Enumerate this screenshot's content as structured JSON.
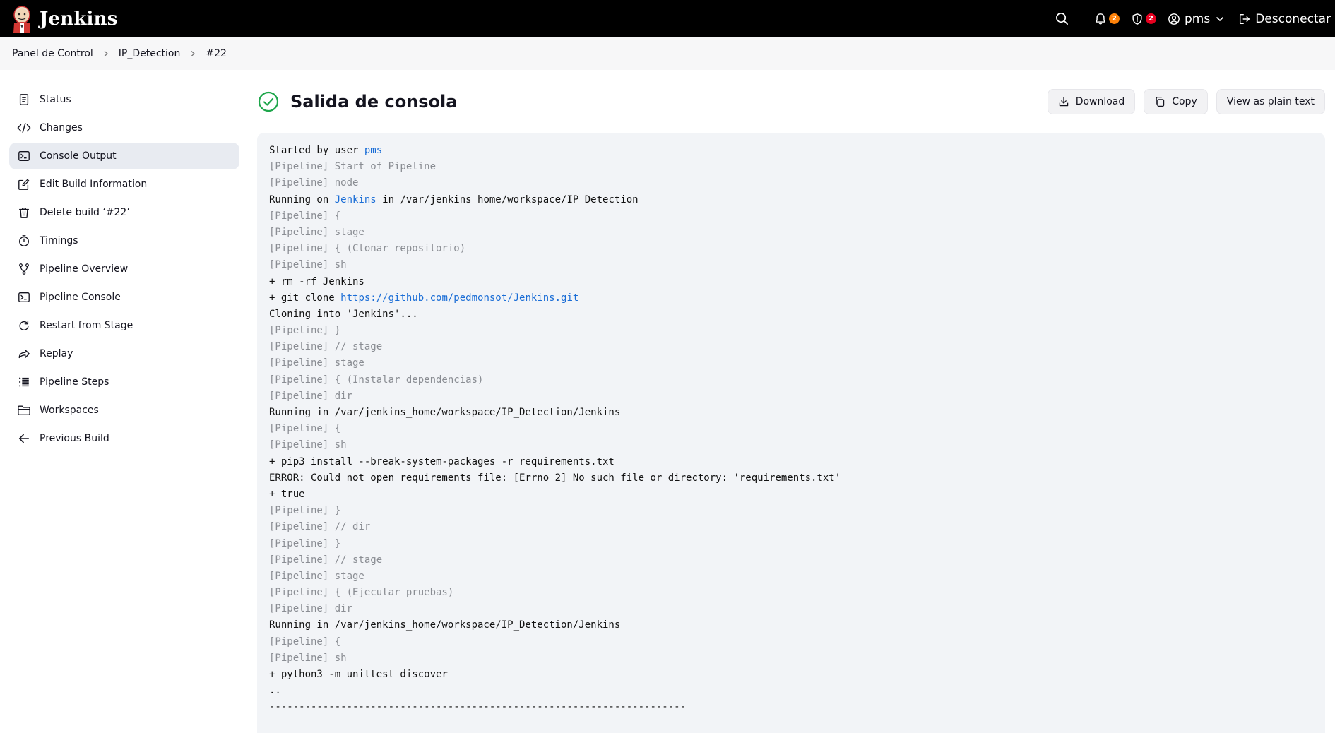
{
  "header": {
    "brand": "Jenkins",
    "notifications_count": "2",
    "security_count": "2",
    "user": "pms",
    "logout_label": "Desconectar"
  },
  "breadcrumbs": [
    "Panel de Control",
    "IP_Detection",
    "#22"
  ],
  "sidebar": {
    "items": [
      {
        "label": "Status",
        "icon": "status-icon"
      },
      {
        "label": "Changes",
        "icon": "code-icon"
      },
      {
        "label": "Console Output",
        "icon": "terminal-icon",
        "active": true
      },
      {
        "label": "Edit Build Information",
        "icon": "edit-icon"
      },
      {
        "label": "Delete build ‘#22’",
        "icon": "trash-icon"
      },
      {
        "label": "Timings",
        "icon": "stopwatch-icon"
      },
      {
        "label": "Pipeline Overview",
        "icon": "pipeline-icon"
      },
      {
        "label": "Pipeline Console",
        "icon": "terminal-icon"
      },
      {
        "label": "Restart from Stage",
        "icon": "restart-icon"
      },
      {
        "label": "Replay",
        "icon": "replay-icon"
      },
      {
        "label": "Pipeline Steps",
        "icon": "list-icon"
      },
      {
        "label": "Workspaces",
        "icon": "folder-icon"
      },
      {
        "label": "Previous Build",
        "icon": "arrow-left-icon"
      }
    ]
  },
  "main": {
    "title": "Salida de consola",
    "buttons": {
      "download": "Download",
      "copy": "Copy",
      "plain_text": "View as plain text"
    }
  },
  "console": [
    {
      "type": "normal",
      "parts": [
        {
          "t": "Started by user "
        },
        {
          "t": "pms",
          "link": true
        }
      ]
    },
    {
      "type": "dim",
      "parts": [
        {
          "t": "[Pipeline] Start of Pipeline"
        }
      ]
    },
    {
      "type": "dim",
      "parts": [
        {
          "t": "[Pipeline] node"
        }
      ]
    },
    {
      "type": "normal",
      "parts": [
        {
          "t": "Running on "
        },
        {
          "t": "Jenkins",
          "link": true
        },
        {
          "t": " in /var/jenkins_home/workspace/IP_Detection"
        }
      ]
    },
    {
      "type": "dim",
      "parts": [
        {
          "t": "[Pipeline] {"
        }
      ]
    },
    {
      "type": "dim",
      "parts": [
        {
          "t": "[Pipeline] stage"
        }
      ]
    },
    {
      "type": "dim",
      "parts": [
        {
          "t": "[Pipeline] { (Clonar repositorio)"
        }
      ]
    },
    {
      "type": "dim",
      "parts": [
        {
          "t": "[Pipeline] sh"
        }
      ]
    },
    {
      "type": "normal",
      "parts": [
        {
          "t": "+ rm -rf Jenkins"
        }
      ]
    },
    {
      "type": "normal",
      "parts": [
        {
          "t": "+ git clone "
        },
        {
          "t": "https://github.com/pedmonsot/Jenkins.git",
          "link": true
        }
      ]
    },
    {
      "type": "normal",
      "parts": [
        {
          "t": "Cloning into 'Jenkins'..."
        }
      ]
    },
    {
      "type": "dim",
      "parts": [
        {
          "t": "[Pipeline] }"
        }
      ]
    },
    {
      "type": "dim",
      "parts": [
        {
          "t": "[Pipeline] // stage"
        }
      ]
    },
    {
      "type": "dim",
      "parts": [
        {
          "t": "[Pipeline] stage"
        }
      ]
    },
    {
      "type": "dim",
      "parts": [
        {
          "t": "[Pipeline] { (Instalar dependencias)"
        }
      ]
    },
    {
      "type": "dim",
      "parts": [
        {
          "t": "[Pipeline] dir"
        }
      ]
    },
    {
      "type": "normal",
      "parts": [
        {
          "t": "Running in /var/jenkins_home/workspace/IP_Detection/Jenkins"
        }
      ]
    },
    {
      "type": "dim",
      "parts": [
        {
          "t": "[Pipeline] {"
        }
      ]
    },
    {
      "type": "dim",
      "parts": [
        {
          "t": "[Pipeline] sh"
        }
      ]
    },
    {
      "type": "normal",
      "parts": [
        {
          "t": "+ pip3 install --break-system-packages -r requirements.txt"
        }
      ]
    },
    {
      "type": "normal",
      "parts": [
        {
          "t": "ERROR: Could not open requirements file: [Errno 2] No such file or directory: 'requirements.txt'"
        }
      ]
    },
    {
      "type": "normal",
      "parts": [
        {
          "t": "+ true"
        }
      ]
    },
    {
      "type": "dim",
      "parts": [
        {
          "t": "[Pipeline] }"
        }
      ]
    },
    {
      "type": "dim",
      "parts": [
        {
          "t": "[Pipeline] // dir"
        }
      ]
    },
    {
      "type": "dim",
      "parts": [
        {
          "t": "[Pipeline] }"
        }
      ]
    },
    {
      "type": "dim",
      "parts": [
        {
          "t": "[Pipeline] // stage"
        }
      ]
    },
    {
      "type": "dim",
      "parts": [
        {
          "t": "[Pipeline] stage"
        }
      ]
    },
    {
      "type": "dim",
      "parts": [
        {
          "t": "[Pipeline] { (Ejecutar pruebas)"
        }
      ]
    },
    {
      "type": "dim",
      "parts": [
        {
          "t": "[Pipeline] dir"
        }
      ]
    },
    {
      "type": "normal",
      "parts": [
        {
          "t": "Running in /var/jenkins_home/workspace/IP_Detection/Jenkins"
        }
      ]
    },
    {
      "type": "dim",
      "parts": [
        {
          "t": "[Pipeline] {"
        }
      ]
    },
    {
      "type": "dim",
      "parts": [
        {
          "t": "[Pipeline] sh"
        }
      ]
    },
    {
      "type": "normal",
      "parts": [
        {
          "t": "+ python3 -m unittest discover"
        }
      ]
    },
    {
      "type": "normal",
      "parts": [
        {
          "t": ".."
        }
      ]
    },
    {
      "type": "normal",
      "parts": [
        {
          "t": "----------------------------------------------------------------------"
        }
      ]
    }
  ]
}
